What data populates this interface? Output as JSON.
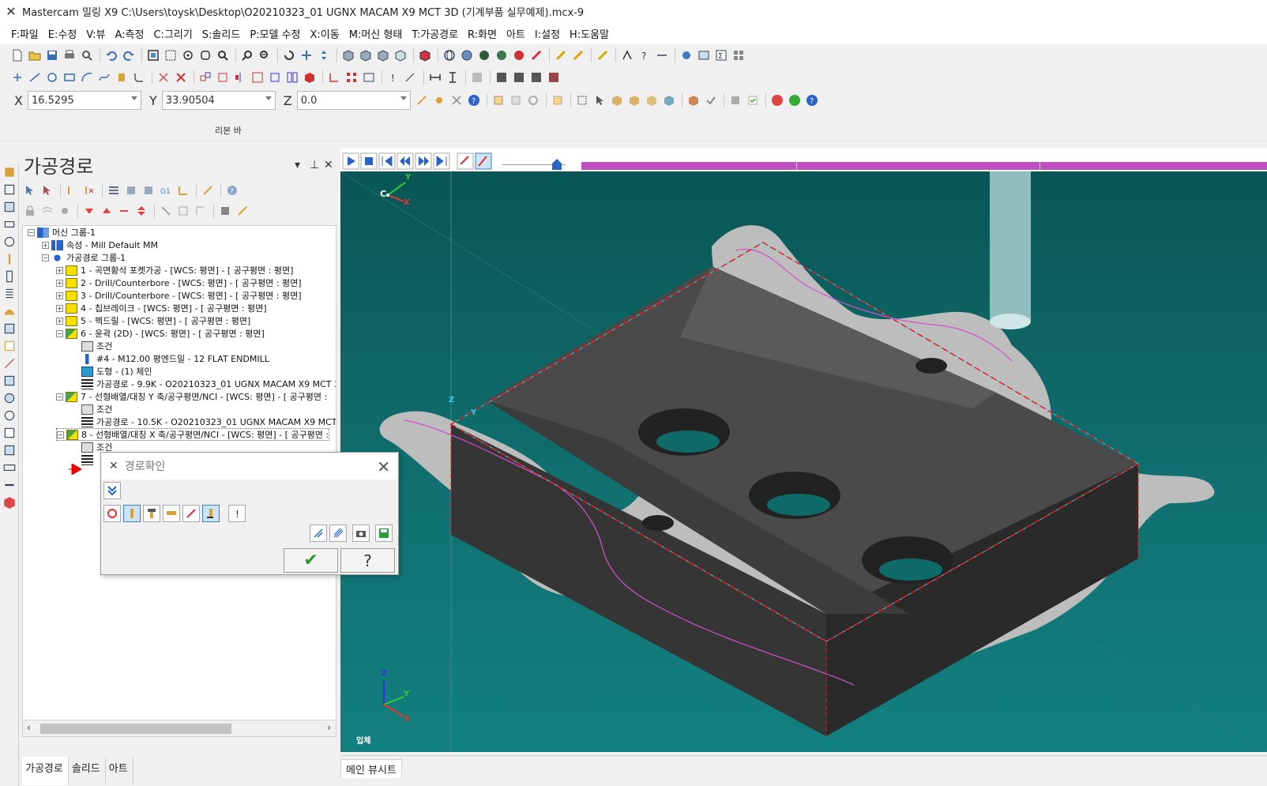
{
  "window": {
    "title": "Mastercam 밀링 X9  C:\\Users\\toysk\\Desktop\\O20210323_01 UGNX MACAM X9 MCT 3D (기계부품 실무예제).mcx-9"
  },
  "menu": [
    "F:파일",
    "E:수정",
    "V:뷰",
    "A:측정",
    "C:그리기",
    "S:솔리드",
    "P:모델 수정",
    "X:이동",
    "M:머신 형태",
    "T:가공경로",
    "R:화면",
    "아트",
    "I:설정",
    "H:도움말"
  ],
  "coords": {
    "x_label": "X",
    "x_value": "16.5295",
    "y_label": "Y",
    "y_value": "33.90504",
    "z_label": "Z",
    "z_value": "0.0"
  },
  "ribbon": {
    "label": "리본 바"
  },
  "panel": {
    "title": "가공경로",
    "pin": "⊥",
    "close": "✕",
    "tree": [
      {
        "text": "머신 그룹-1"
      },
      {
        "text": "속성 - Mill Default MM"
      },
      {
        "text": "가공경로 그룹-1"
      },
      {
        "text": "1 - 곡면황삭 포켓가공 - [WCS: 평면] - [ 공구평면 : 평면]"
      },
      {
        "text": "2 - Drill/Counterbore - [WCS: 평면] - [ 공구평면 : 평면]"
      },
      {
        "text": "3 - Drill/Counterbore - [WCS: 평면] - [ 공구평면 : 평면]"
      },
      {
        "text": "4 - 칩브레이크 - [WCS: 평면] - [ 공구평면 : 평면]"
      },
      {
        "text": "5 - 펙드릴 - [WCS: 평면] - [ 공구평면 : 평면]"
      },
      {
        "text": "6 - 윤곽 (2D) - [WCS: 평면] - [ 공구평면 : 평면]"
      },
      {
        "text": "조건"
      },
      {
        "text": "#4 - M12.00 평엔드밀 - 12 FLAT ENDMILL"
      },
      {
        "text": "도형 - (1) 체인"
      },
      {
        "text": "가공경로 - 9.9K - O20210323_01 UGNX MACAM X9 MCT 3D (기"
      },
      {
        "text": "7 - 선형배열/대칭 Y 축/공구평면/NCI - [WCS: 평면] - [ 공구평면 :"
      },
      {
        "text": "조건"
      },
      {
        "text": "가공경로 - 10.5K - O20210323_01 UGNX MACAM X9 MCT 3D (기"
      },
      {
        "text": "8 - 선형배열/대칭 X 축/공구평면/NCI - [WCS: 평면] - [ 공구평면 :"
      },
      {
        "text": "조건"
      }
    ]
  },
  "bottom_tabs": [
    "가공경로",
    "솔리드",
    "아트"
  ],
  "dialog": {
    "title": "경로확인",
    "close": "✕",
    "ok": "✔",
    "help": "?"
  },
  "viewport": {
    "view_label": "입체",
    "bottom_tab": "메인 뷰시트",
    "axis_c": "C",
    "axis_x": "X",
    "axis_y": "Y",
    "axis_z": "Z"
  },
  "colors": {
    "gfx_bg": "#0f6a6a",
    "toolpath": "#d64fd0",
    "boundary_red": "#e0202a",
    "boundary_cyan": "#38d0e0",
    "part": "#3e3e3e",
    "stock_grey": "#bdbdbd",
    "progress": "#c050c0"
  },
  "icons": [
    "new-file-icon",
    "open-icon",
    "save-icon",
    "print-icon",
    "undo-icon",
    "redo-icon",
    "zoom-icon",
    "shade-icon",
    "check-icon",
    "help-icon"
  ]
}
